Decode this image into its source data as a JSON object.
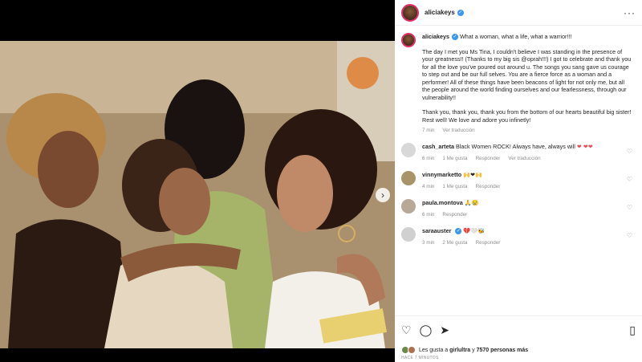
{
  "post": {
    "author": "aliciakeys",
    "caption_lines": [
      "What a woman, what a life, what a warrior!!!",
      "The day I met you Ms Tina, I couldn't believe I was standing in the presence of your greatness!! (Thanks to my big sis @oprah!!!) I got to celebrate and thank you for all the love you've poured out around u. The songs you sang gave us courage to step out and be our full selves. You are a fierce force as a woman and a performer! All of these things have been beacons of light for not only me, but all the people around the world finding ourselves and our fearlessness, through our vulnerability!!",
      "Thank you, thank you, thank you from the bottom of our hearts beautiful big sister! Rest well! We love and adore you infinetly!"
    ],
    "time": "7 min",
    "translate": "Ver traducción"
  },
  "comments": [
    {
      "user": "cash_arteta",
      "text": "Black Women ROCK! Always have, always will",
      "emoji": "❤ ❤❤",
      "time": "6 min",
      "likes": "1 Me gusta",
      "reply": "Responder",
      "translate": "Ver traducción",
      "avatar_color": "#d8d8d8"
    },
    {
      "user": "vinnymarketto",
      "text": "",
      "emoji": "🙌❤🙌",
      "time": "4 min",
      "likes": "1 Me gusta",
      "reply": "Responder",
      "translate": "",
      "avatar_color": "#a89468"
    },
    {
      "user": "paula.montova",
      "text": "",
      "emoji": "🙏😢",
      "time": "6 min",
      "likes": "",
      "reply": "Responder",
      "translate": "",
      "avatar_color": "#b8a898"
    },
    {
      "user": "saraauster",
      "text": "",
      "emoji": "💔🤍🐝",
      "time": "3 min",
      "likes": "2 Me gusta",
      "reply": "Responder",
      "translate": "",
      "avatar_color": "#d0d0d0"
    }
  ],
  "footer": {
    "likes_text_pre": "Les gusta a ",
    "likes_user": "girlultra",
    "likes_text_mid": " y ",
    "likes_count": "7570 personas más",
    "ago": "HACE 7 MINUTOS"
  },
  "icons": {
    "more": "more-options-icon",
    "heart": "heart-icon",
    "comment": "comment-icon",
    "share": "share-icon",
    "bookmark": "bookmark-icon",
    "verified": "verified-badge-icon",
    "next": "chevron-right-icon"
  },
  "colors": {
    "accent": "#3897f0",
    "like": "#ed4956"
  }
}
